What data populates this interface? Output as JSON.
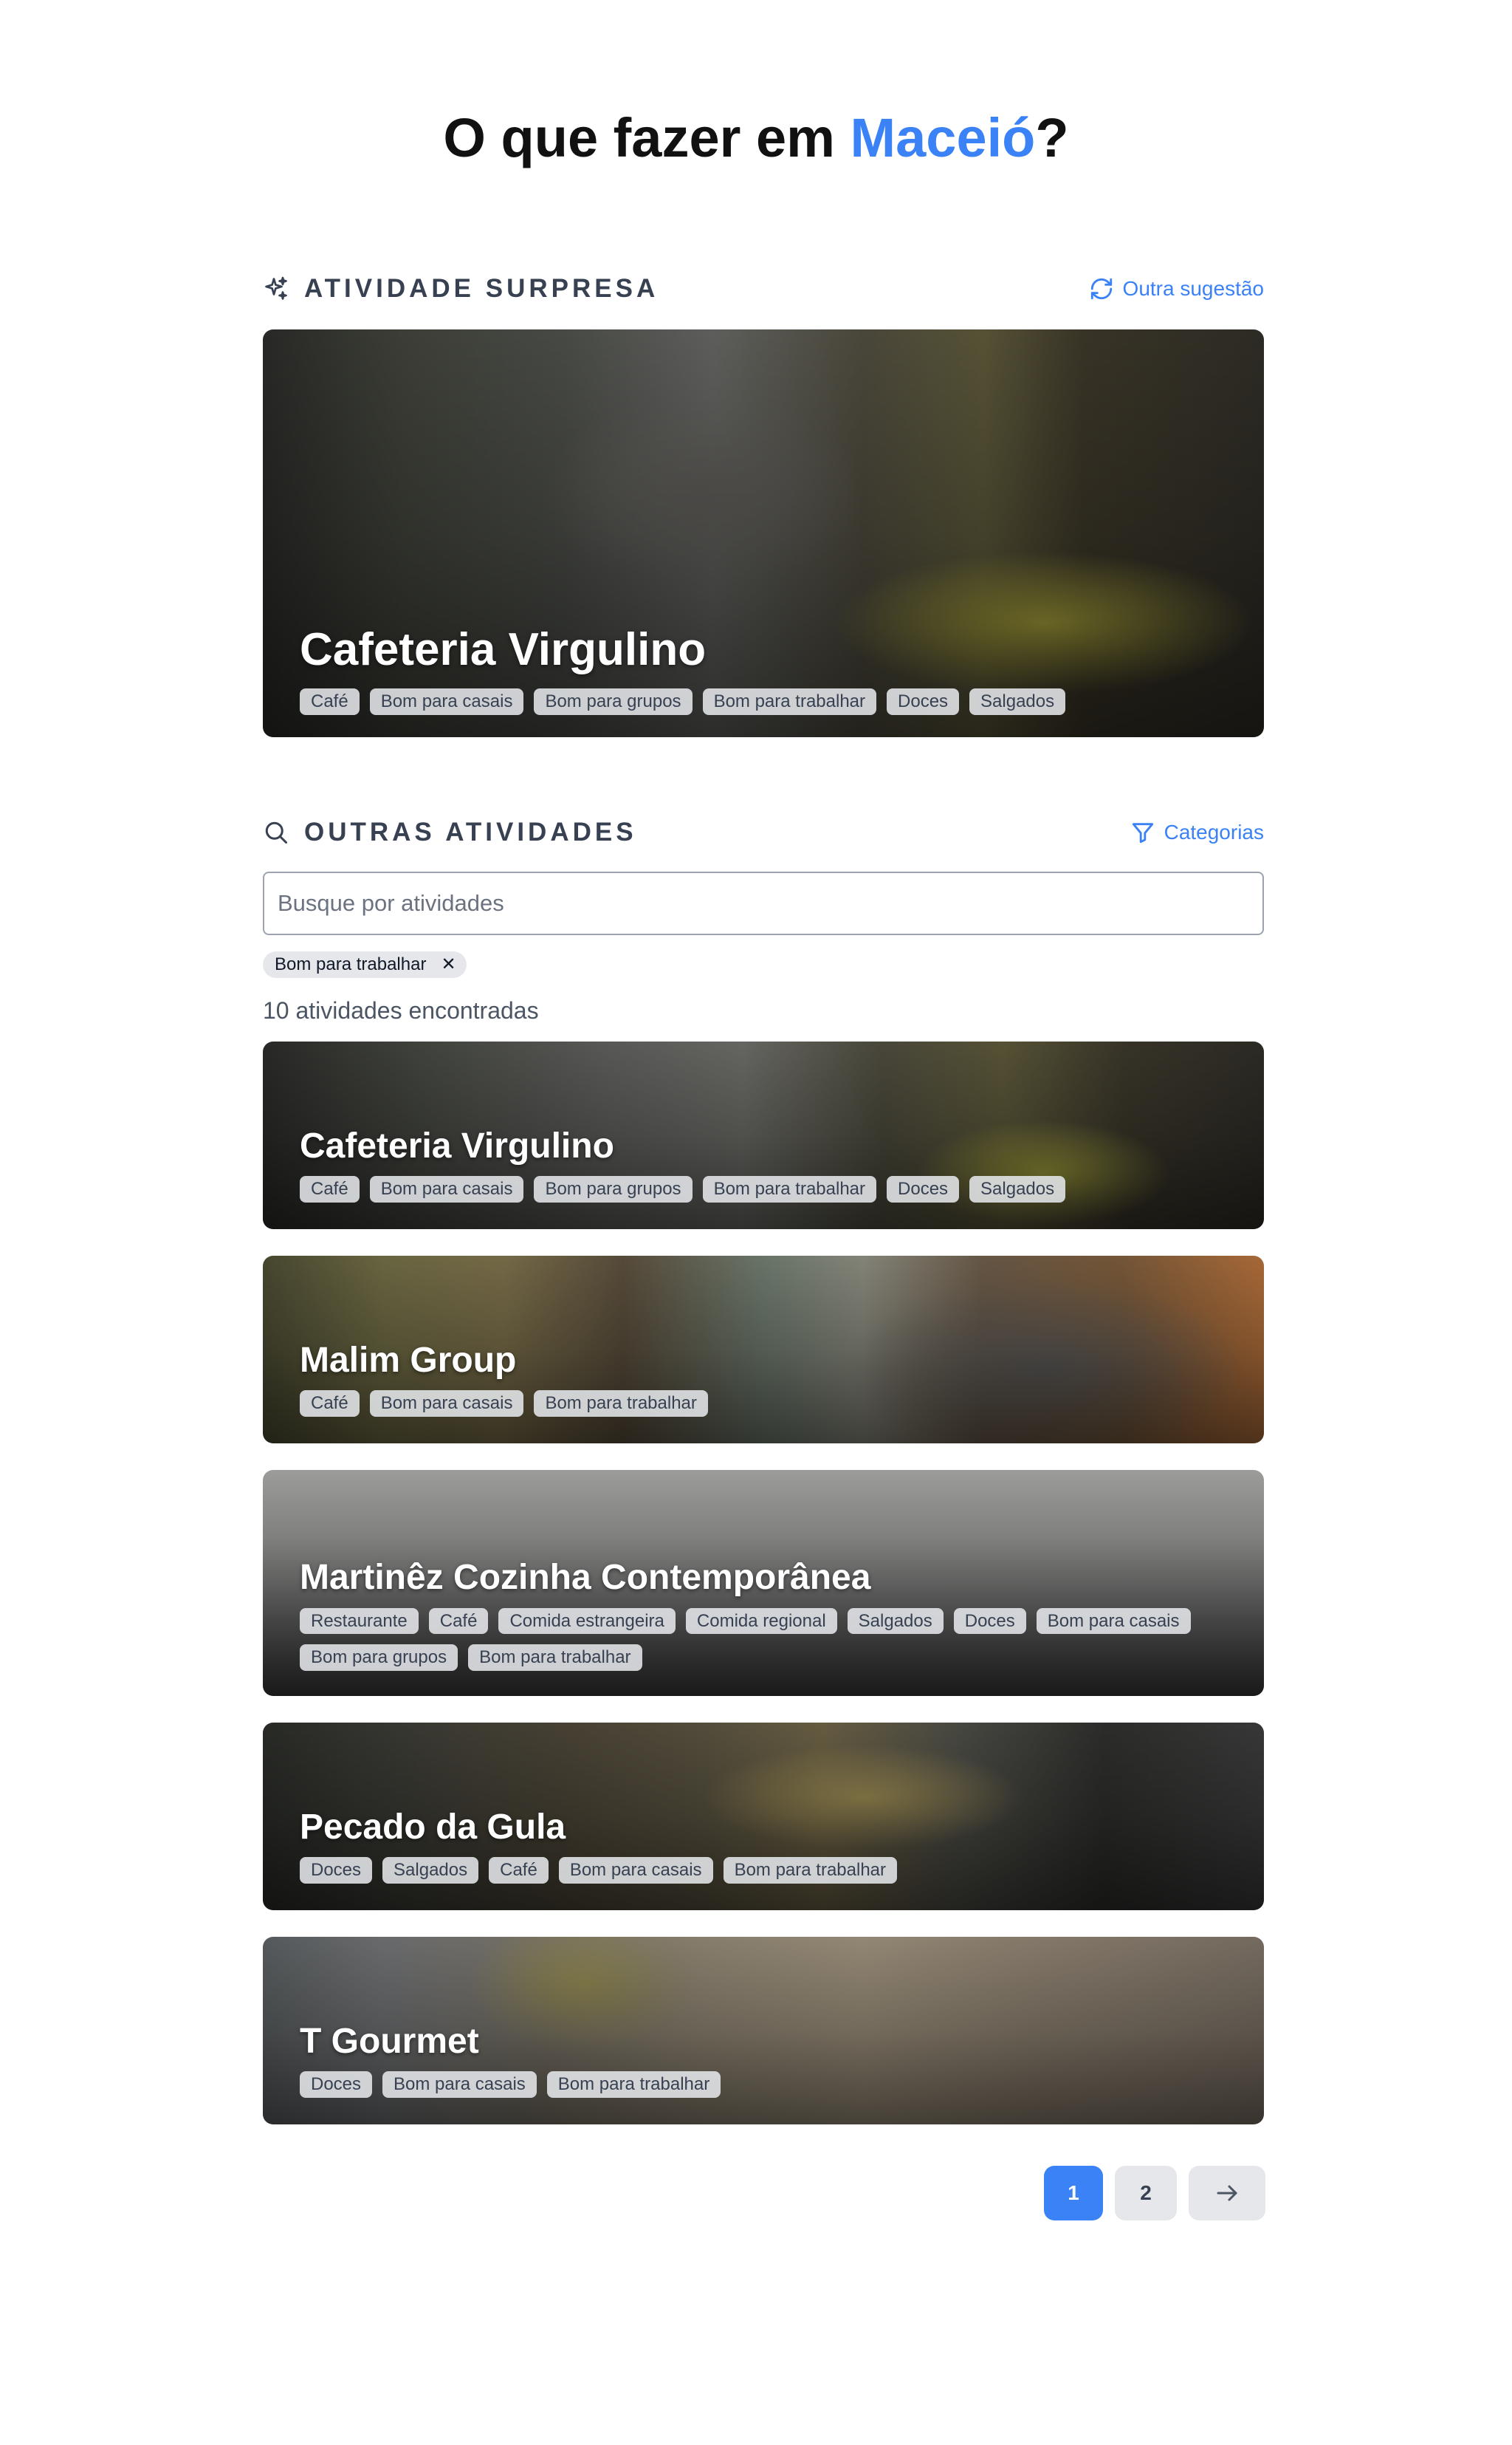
{
  "header": {
    "title_prefix": "O que fazer em ",
    "city": "Maceió",
    "title_suffix": "?"
  },
  "surprise": {
    "section_title": "ATIVIDADE SURPRESA",
    "refresh_label": "Outra sugestão",
    "card": {
      "name": "Cafeteria Virgulino",
      "tags": [
        "Café",
        "Bom para casais",
        "Bom para grupos",
        "Bom para trabalhar",
        "Doces",
        "Salgados"
      ]
    }
  },
  "others": {
    "section_title": "OUTRAS ATIVIDADES",
    "categories_label": "Categorias",
    "search_placeholder": "Busque por atividades",
    "active_filters": [
      "Bom para trabalhar"
    ],
    "result_count_text": "10 atividades encontradas",
    "activities": [
      {
        "name": "Cafeteria Virgulino",
        "tags": [
          "Café",
          "Bom para casais",
          "Bom para grupos",
          "Bom para trabalhar",
          "Doces",
          "Salgados"
        ]
      },
      {
        "name": "Malim Group",
        "tags": [
          "Café",
          "Bom para casais",
          "Bom para trabalhar"
        ]
      },
      {
        "name": "Martinêz Cozinha Contemporânea",
        "tags": [
          "Restaurante",
          "Café",
          "Comida estrangeira",
          "Comida regional",
          "Salgados",
          "Doces",
          "Bom para casais",
          "Bom para grupos",
          "Bom para trabalhar"
        ]
      },
      {
        "name": "Pecado da Gula",
        "tags": [
          "Doces",
          "Salgados",
          "Café",
          "Bom para casais",
          "Bom para trabalhar"
        ]
      },
      {
        "name": "T Gourmet",
        "tags": [
          "Doces",
          "Bom para casais",
          "Bom para trabalhar"
        ]
      }
    ]
  },
  "pagination": {
    "current": "1",
    "next_page": "2",
    "next_icon": "arrow-right-icon"
  },
  "colors": {
    "accent": "#3b82f6",
    "section_title": "#374151",
    "tag_bg": "#e5e7eb"
  }
}
